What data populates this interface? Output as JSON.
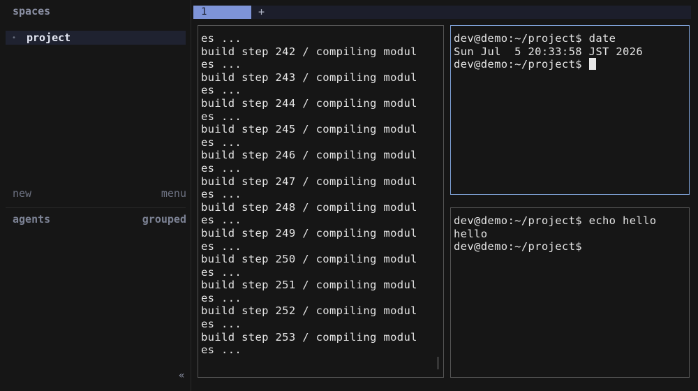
{
  "sidebar": {
    "header": "spaces",
    "spaces": [
      {
        "label": "project",
        "bullet": "•"
      }
    ],
    "new_label": "new",
    "menu_label": "menu",
    "agents_label": "agents",
    "grouped_label": "grouped",
    "collapse_glyph": "«"
  },
  "tabs": {
    "items": [
      {
        "label": "1"
      }
    ],
    "add_label": "+"
  },
  "panes": {
    "build_log": [
      "es ...",
      "build step 242 / compiling modul",
      "es ...",
      "build step 243 / compiling modul",
      "es ...",
      "build step 244 / compiling modul",
      "es ...",
      "build step 245 / compiling modul",
      "es ...",
      "build step 246 / compiling modul",
      "es ...",
      "build step 247 / compiling modul",
      "es ...",
      "build step 248 / compiling modul",
      "es ...",
      "build step 249 / compiling modul",
      "es ...",
      "build step 250 / compiling modul",
      "es ...",
      "build step 251 / compiling modul",
      "es ...",
      "build step 252 / compiling modul",
      "es ...",
      "build step 253 / compiling modul",
      "es ..."
    ],
    "top_right": {
      "lines": [
        "dev@demo:~/project$ date",
        "Sun Jul  5 20:33:58 JST 2026"
      ],
      "prompt": "dev@demo:~/project$ "
    },
    "bottom_right": {
      "lines": [
        "dev@demo:~/project$ echo hello",
        "hello",
        "dev@demo:~/project$"
      ]
    }
  },
  "colors": {
    "accent": "#7e94d8",
    "active_border": "#7ea1d6",
    "background": "#161616"
  }
}
